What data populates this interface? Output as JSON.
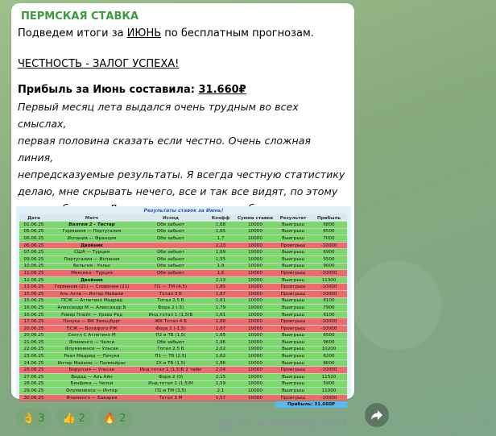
{
  "message": {
    "channel": "ПЕРМСКАЯ СТАВКА",
    "line1_a": "Подведем итоги за ",
    "line1_b": "ИЮНЬ",
    "line1_c": " по бесплатным прогнозам.",
    "honesty": "ЧЕСТНОСТЬ - ЗАЛОГ УСПЕХА!",
    "profit_label": "Прибыль за Июнь составила: ",
    "profit_value": "31.660₽",
    "body": "Первый месяц лета выдался очень трудным во всех смыслах,\nпервая половина сказать если честно. Очень сложная линия,\nнепредсказуемые результаты. Я всегда честную статистику\nделаю, мне скрывать нечего, все и так все видят, по этому\nдальше больше. Летом статистика может быть чуть хуже, т.к\nкоманды в отпуске, сезон напоминаю начинается с сентября по\nмай."
  },
  "table": {
    "title": "Результаты ставок за Июнь!",
    "headers": [
      "Дата",
      "Матч",
      "Исход",
      "Коэфф",
      "Сумма ставки",
      "Результат",
      "Прибыль"
    ],
    "rows": [
      [
        "01.06.25",
        "Вилгем 2 - Тестар",
        "Обе забьют",
        "1,68",
        "10000",
        "Выигрыш",
        "6800",
        "win"
      ],
      [
        "05.06.25",
        "Германия — Португалия",
        "Обе забьют",
        "1,65",
        "10000",
        "Выигрыш",
        "6500",
        "win"
      ],
      [
        "06.06.25",
        "Испания — Франция",
        "Обе забьют",
        "1,7",
        "10000",
        "Выигрыш",
        "7000",
        "win"
      ],
      [
        "06.06.25",
        "Двойник",
        "",
        "2,23",
        "10000",
        "Проигрыш",
        "-10000",
        "lose"
      ],
      [
        "07.06.25",
        "США — Турция",
        "Обе забьют",
        "1,69",
        "10000",
        "Выигрыш",
        "6900",
        "win"
      ],
      [
        "09.06.25",
        "Португалия — Испания",
        "Обе забьют",
        "1,55",
        "10000",
        "Выигрыш",
        "5500",
        "win"
      ],
      [
        "10.06.25",
        "Бельгия - Уэльс",
        "Обе забьют",
        "1,9",
        "10000",
        "Выигрыш",
        "9000",
        "win"
      ],
      [
        "11.06.25",
        "Мексика - Турция",
        "Обе забьют",
        "1,6",
        "10000",
        "Проигрыш",
        "-10000",
        "lose"
      ],
      [
        "12.06.25",
        "Двойник",
        "",
        "2,13",
        "10000",
        "Выигрыш",
        "11300",
        "win"
      ],
      [
        "13.06.25",
        "Германия (21) — Словения (21)",
        "П1 — ТМ (4,5)",
        "1,85",
        "10000",
        "Проигрыш",
        "-10000",
        "lose"
      ],
      [
        "15.06.25",
        "Аль Ахли — Интер Майами",
        "Тотал 3 Б",
        "1,87",
        "10000",
        "Проигрыш",
        "-10000",
        "lose"
      ],
      [
        "15.06.25",
        "ПСЖ — Атлетико Мадрид",
        "Тотал 2,5 Б",
        "1,61",
        "10000",
        "Выигрыш",
        "6100",
        "win"
      ],
      [
        "16.06.25",
        "Александр М — Александр Б",
        "Фора 2 (-3)",
        "1,79",
        "10000",
        "Выигрыш",
        "7900",
        "win"
      ],
      [
        "16.06.25",
        "Ривер Плейт — Урава Ред",
        "Инд.тотал 1 (1,5)Б",
        "1,61",
        "10000",
        "Выигрыш",
        "6100",
        "win"
      ],
      [
        "17.06.25",
        "Пачука — ФК Зальцбург",
        "ЖК Тотал 4 Б",
        "1,68",
        "10000",
        "Проигрыш",
        "-10000",
        "lose"
      ],
      [
        "20.06.25",
        "ПСЖ — Ботафого РЖ",
        "Фора 1 (-1,5)",
        "1,67",
        "10000",
        "Проигрыш",
        "-10000",
        "lose"
      ],
      [
        "20.06.25",
        "Сиэтл С  Атлетико М",
        "П2 и ТБ (1,5)",
        "1,65",
        "10000",
        "Выигрыш",
        "6500",
        "win"
      ],
      [
        "21.06.25",
        "Фламенго — Челси",
        "Обе забьют",
        "1,96",
        "10000",
        "Выигрыш",
        "9600",
        "win"
      ],
      [
        "22.06.25",
        "Флуминенсе — Ульсан",
        "Тотал 2,5 Б",
        "2,02",
        "10000",
        "Выигрыш",
        "10200",
        "win"
      ],
      [
        "23.06.25",
        "Реал Мадрид — Пачука",
        "П1 — ТБ (2,5)",
        "1,62",
        "10000",
        "Выигрыш",
        "6200",
        "win"
      ],
      [
        "24.06.25",
        "Интер Майами — Палмейрас",
        "2Х и ТБ (1,5)",
        "1,86",
        "10000",
        "Выигрыш",
        "8600",
        "win"
      ],
      [
        "26.06.25",
        "Боруссия — Ульсан",
        "Инд.тотал 1 (1,5)Б 2 тайм",
        "2,04",
        "10000",
        "Проигрыш",
        "-10000",
        "lose"
      ],
      [
        "27.06.25",
        "Видад — Аль Айн",
        "Фора 2 (0)",
        "2,15",
        "10000",
        "Выигрыш",
        "11520",
        "win"
      ],
      [
        "28.06.25",
        "Бенфика — Челси",
        "Инд.тотал 1 (1,5)М",
        "1,59",
        "10000",
        "Выигрыш",
        "5900",
        "win"
      ],
      [
        "29.06.25",
        "Флуминенсе — Интер",
        "П1 и ТМ (3,5)",
        "2,1",
        "10000",
        "Выигрыш",
        "11000",
        "win"
      ],
      [
        "30.06.25",
        "Фламенго — Бавария",
        "Тотал 3 М",
        "1,57",
        "10000",
        "Проигрыш",
        "-10000",
        "lose"
      ]
    ],
    "total": "Прибыль: 31.660Р"
  },
  "reactions": [
    {
      "emoji": "👌",
      "count": "3"
    },
    {
      "emoji": "👍",
      "count": "2"
    },
    {
      "emoji": "🔥",
      "count": "2"
    }
  ],
  "meta": {
    "views": "76",
    "edited": "изменено 21:21"
  },
  "colors": {
    "accent": "#3a9b40",
    "win": "#7dd86a",
    "lose": "#f06a6a",
    "total": "#5bb7f0"
  }
}
